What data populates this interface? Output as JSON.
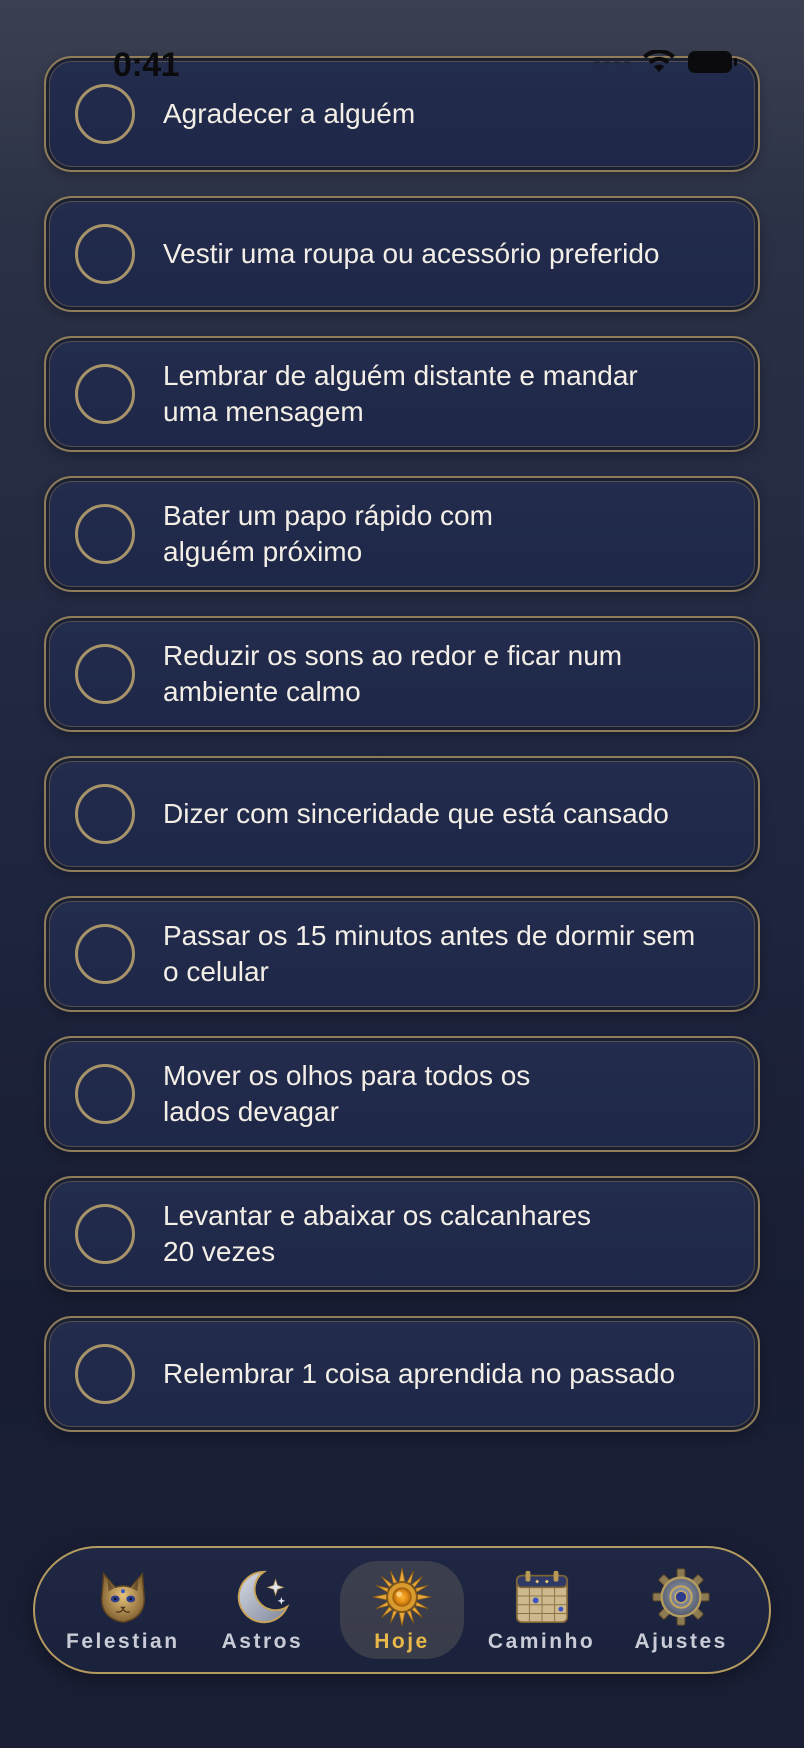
{
  "status_bar": {
    "time": "0:41"
  },
  "tasks": [
    {
      "label": "Agradecer a alguém",
      "checked": false
    },
    {
      "label": "Vestir uma roupa ou acessório preferido",
      "checked": false
    },
    {
      "label": "Lembrar de alguém distante e mandar\numa mensagem",
      "checked": false
    },
    {
      "label": "Bater um papo rápido com\nalguém próximo",
      "checked": false
    },
    {
      "label": "Reduzir os sons ao redor e ficar num\nambiente calmo",
      "checked": false
    },
    {
      "label": "Dizer com sinceridade que está cansado",
      "checked": false
    },
    {
      "label": "Passar os 15 minutos antes de dormir sem\no celular",
      "checked": false
    },
    {
      "label": "Mover os olhos para todos os\nlados devagar",
      "checked": false
    },
    {
      "label": "Levantar e abaixar os calcanhares\n20 vezes",
      "checked": false
    },
    {
      "label": "Relembrar 1 coisa aprendida no passado",
      "checked": false
    }
  ],
  "tab_bar": {
    "active": "hoje",
    "tabs": [
      {
        "id": "felestian",
        "label": "Felestian",
        "icon": "cat-icon"
      },
      {
        "id": "astros",
        "label": "Astros",
        "icon": "crescent-moon-icon"
      },
      {
        "id": "hoje",
        "label": "Hoje",
        "icon": "sun-icon"
      },
      {
        "id": "caminho",
        "label": "Caminho",
        "icon": "calendar-icon"
      },
      {
        "id": "ajustes",
        "label": "Ajustes",
        "icon": "gear-icon"
      }
    ]
  },
  "colors": {
    "accent_gold": "#b39a5f",
    "active_tab_label": "#e8b94a",
    "card_background": "#212a4a",
    "background_dark": "#181d33"
  }
}
